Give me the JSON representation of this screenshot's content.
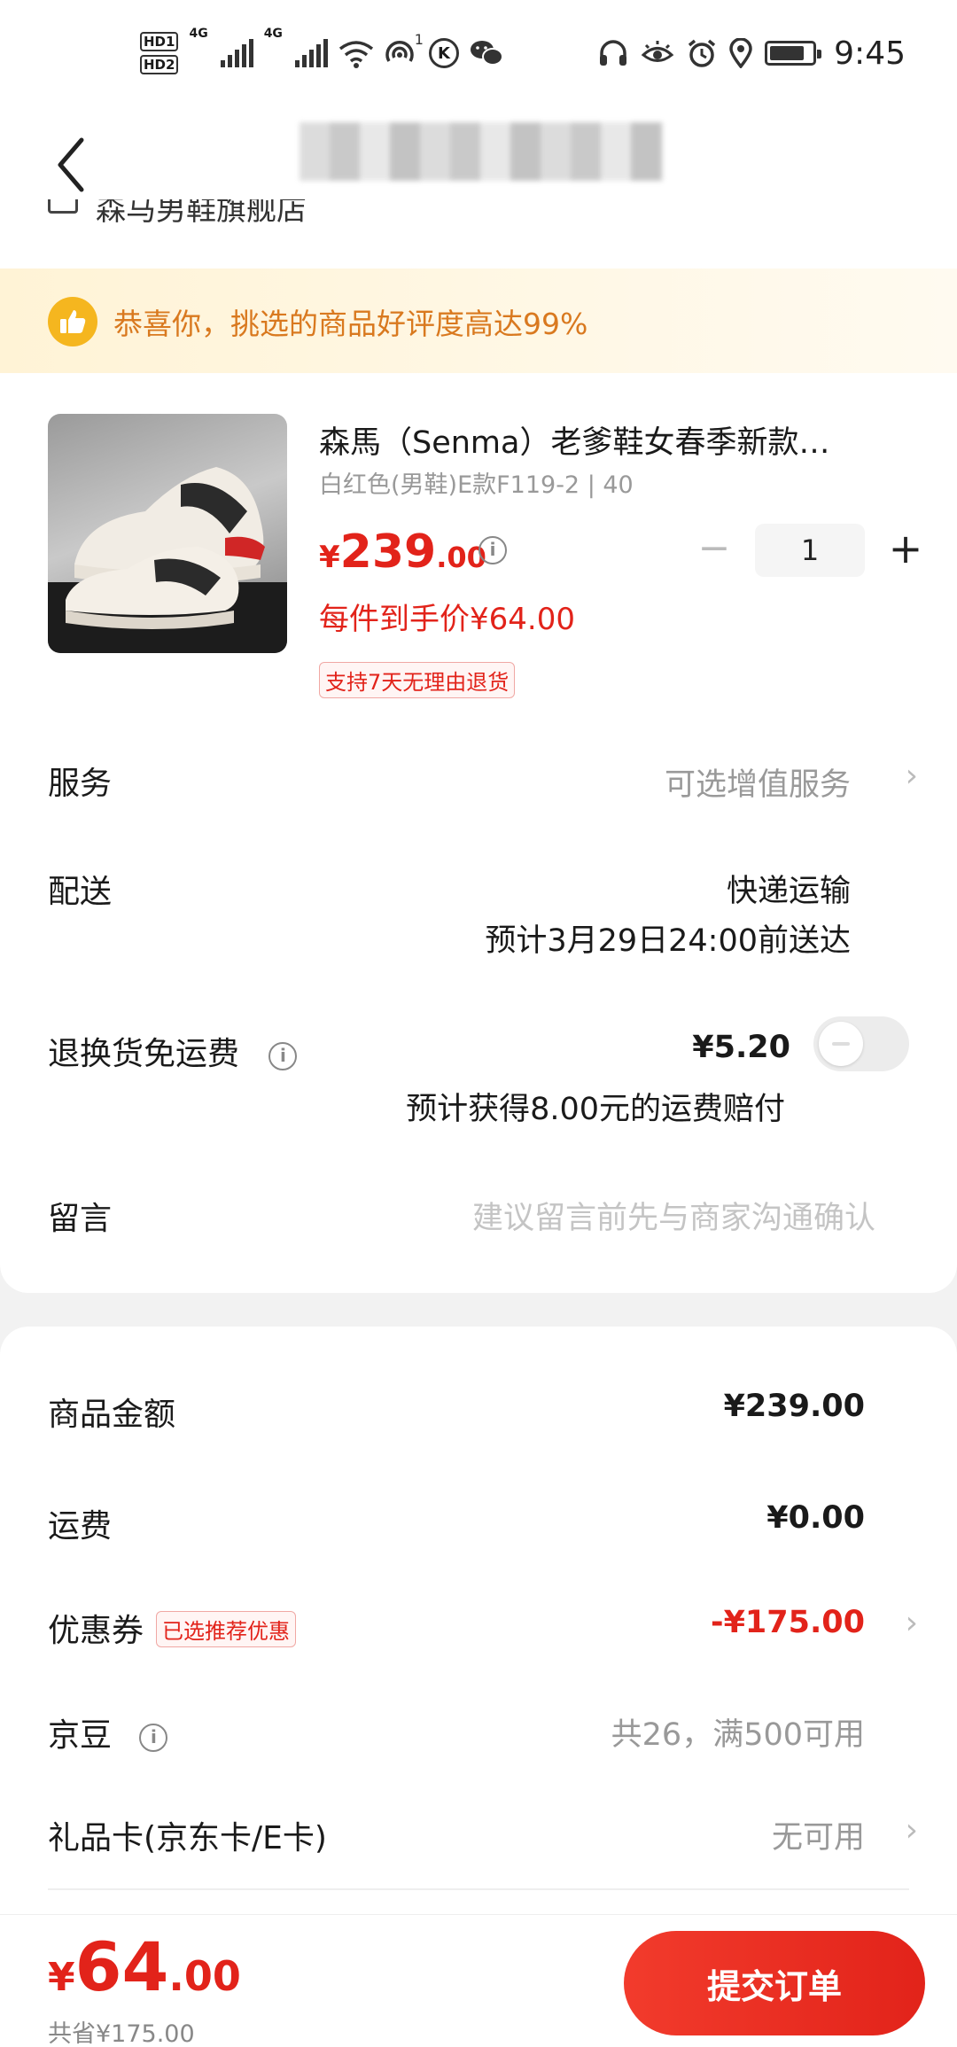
{
  "status_bar": {
    "time": "9:45",
    "hd1": "HD1",
    "hd2": "HD2",
    "net1": "4G",
    "net2": "4G",
    "hotspot_count": "1",
    "k_badge": "K",
    "battery_level": 0.85
  },
  "nav": {
    "store_name": "森马男鞋旗舰店"
  },
  "banner": {
    "text": "恭喜你，挑选的商品好评度高达99%"
  },
  "product": {
    "title": "森馬（Senma）老爹鞋女春季新款…",
    "sku": "白红色(男鞋)E款F119-2 | 40",
    "price_currency": "¥",
    "price_int": "239",
    "price_dec": ".00",
    "each_price": "每件到手价¥64.00",
    "return_tag": "支持7天无理由退货",
    "quantity": "1",
    "minus": "−",
    "plus": "+"
  },
  "rows": {
    "service_label": "服务",
    "service_value": "可选增值服务",
    "delivery_label": "配送",
    "delivery_method": "快递运输",
    "delivery_eta": "预计3月29日24:00前送达",
    "return_shipping_label": "退换货免运费",
    "return_shipping_price": "¥5.20",
    "return_shipping_note": "预计获得8.00元的运费赔付",
    "return_shipping_enabled": false,
    "message_label": "留言",
    "message_placeholder": "建议留言前先与商家沟通确认"
  },
  "summary": {
    "goods_label": "商品金额",
    "goods_value": "¥239.00",
    "freight_label": "运费",
    "freight_value": "¥0.00",
    "coupon_label": "优惠券",
    "coupon_tag": "已选推荐优惠",
    "coupon_value": "-¥175.00",
    "jingdou_label": "京豆",
    "jingdou_value": "共26，满500可用",
    "giftcard_label": "礼品卡(京东卡/E卡)",
    "giftcard_value": "无可用"
  },
  "bottom": {
    "total_currency": "¥",
    "total_int": "64",
    "total_dec": ".00",
    "saved": "共省¥175.00",
    "submit": "提交订单"
  },
  "colors": {
    "accent": "#e2231a",
    "banner_text": "#d9791f",
    "banner_icon": "#f5b61f"
  },
  "icons": {
    "back": "chevron-left-icon",
    "info": "info-icon",
    "chevron": "chevron-right-icon",
    "thumbs_up": "thumbs-up-icon"
  }
}
